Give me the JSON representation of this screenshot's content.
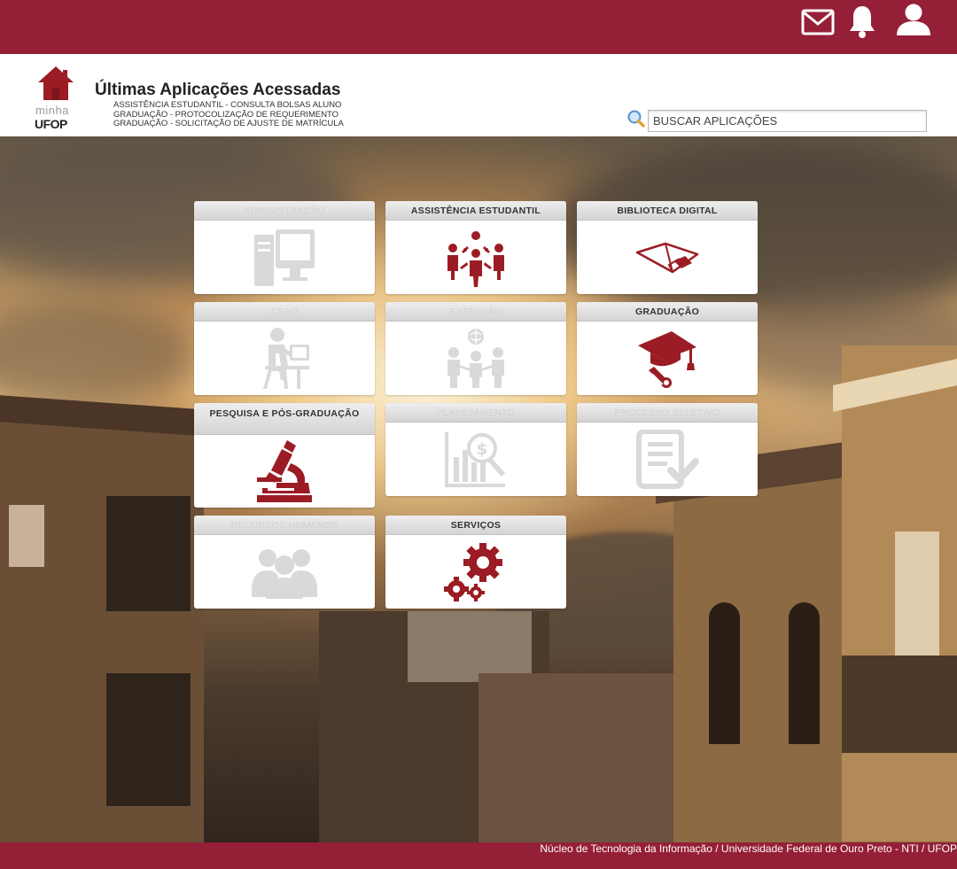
{
  "topbar": {
    "background": "#951f36",
    "icons": [
      "mail-icon",
      "bell-icon",
      "user-icon"
    ]
  },
  "logo": {
    "line1": "minha",
    "line2": "UFOP"
  },
  "recent": {
    "title": "Últimas Aplicações Acessadas",
    "items": [
      "ASSISTÊNCIA ESTUDANTIL - CONSULTA BOLSAS ALUNO",
      "GRADUAÇÃO - PROTOCOLIZAÇÃO DE REQUERIMENTO",
      "GRADUAÇÃO - SOLICITAÇÃO DE AJUSTE DE MATRÍCULA"
    ]
  },
  "search": {
    "placeholder": "BUSCAR APLICAÇÕES",
    "icon": "magnifier-icon"
  },
  "colors": {
    "brand": "#951f36",
    "icon_active": "#9b1c24",
    "icon_disabled": "#d9d9d9"
  },
  "tiles": [
    {
      "label": "ADMINISTRAÇÃO",
      "icon": "computer-icon",
      "enabled": false
    },
    {
      "label": "ASSISTÊNCIA ESTUDANTIL",
      "icon": "students-group-icon",
      "enabled": true
    },
    {
      "label": "BIBLIOTECA DIGITAL",
      "icon": "open-book-icon",
      "enabled": true
    },
    {
      "label": "CEAD",
      "icon": "distance-learning-icon",
      "enabled": false
    },
    {
      "label": "EXTENSÃO",
      "icon": "community-globe-icon",
      "enabled": false
    },
    {
      "label": "GRADUAÇÃO",
      "icon": "graduation-cap-icon",
      "enabled": true
    },
    {
      "label": "PESQUISA E PÓS-GRADUAÇÃO",
      "icon": "microscope-icon",
      "enabled": true
    },
    {
      "label": "PLANEJAMENTO",
      "icon": "chart-money-icon",
      "enabled": false
    },
    {
      "label": "PROCESSO SELETIVO",
      "icon": "checklist-icon",
      "enabled": false
    },
    {
      "label": "RECURSOS HUMANOS",
      "icon": "people-icon",
      "enabled": false
    },
    {
      "label": "SERVIÇOS",
      "icon": "gears-icon",
      "enabled": true
    }
  ],
  "footer": {
    "text": "Núcleo de Tecnologia da Informação / Universidade Federal de Ouro Preto - NTI / UFOP"
  }
}
